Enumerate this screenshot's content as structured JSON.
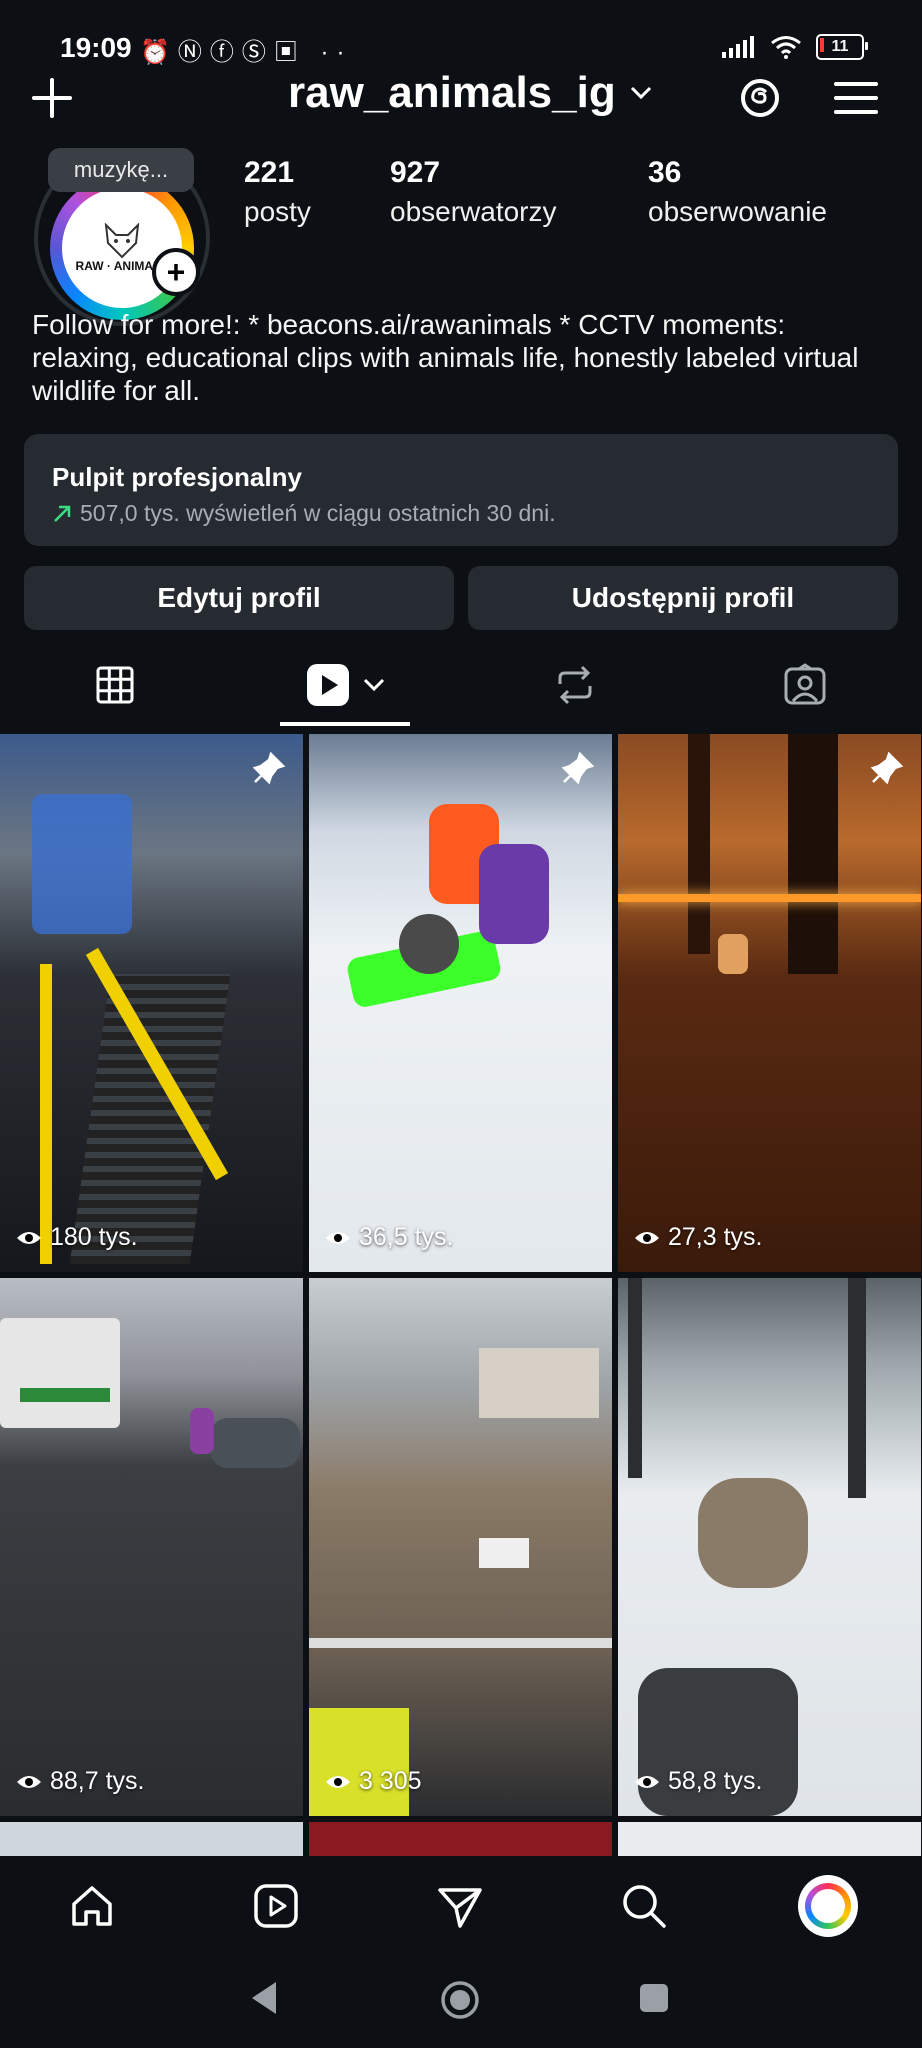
{
  "status_bar": {
    "time": "19:09",
    "left_icons": [
      "alarm-icon",
      "nfc-icon",
      "facebook-icon",
      "fire-icon",
      "save-icon",
      "more-dots-icon"
    ],
    "notif_glyphs": "⏰ⓃⓕⓈ▣ ··",
    "battery": "11"
  },
  "header": {
    "username": "raw_animals_ig"
  },
  "profile": {
    "note": "muzykę...",
    "avatar_text": "RAW · ANIMALS",
    "stats": [
      {
        "value": "221",
        "label": "posty"
      },
      {
        "value": "927",
        "label": "obserwatorzy"
      },
      {
        "value": "36",
        "label": "obserwowanie"
      }
    ],
    "bio": "Follow for more!: * beacons.ai/rawanimals * CCTV moments: relaxing, educational clips with animals life, honestly labeled virtual wildlife for all."
  },
  "dashboard": {
    "title": "Pulpit profesjonalny",
    "subtitle": "507,0 tys. wyświetleń w ciągu ostatnich 30 dni.",
    "trend_color": "#3ddc84"
  },
  "buttons": {
    "edit": "Edytuj profil",
    "share": "Udostępnij profil"
  },
  "tiles": [
    {
      "views": "180 tys.",
      "pinned": true
    },
    {
      "views": "36,5 tys.",
      "pinned": true
    },
    {
      "views": "27,3 tys.",
      "pinned": true
    },
    {
      "views": "88,7 tys.",
      "pinned": false
    },
    {
      "views": "3 305",
      "pinned": false
    },
    {
      "views": "58,8 tys.",
      "pinned": false
    }
  ]
}
